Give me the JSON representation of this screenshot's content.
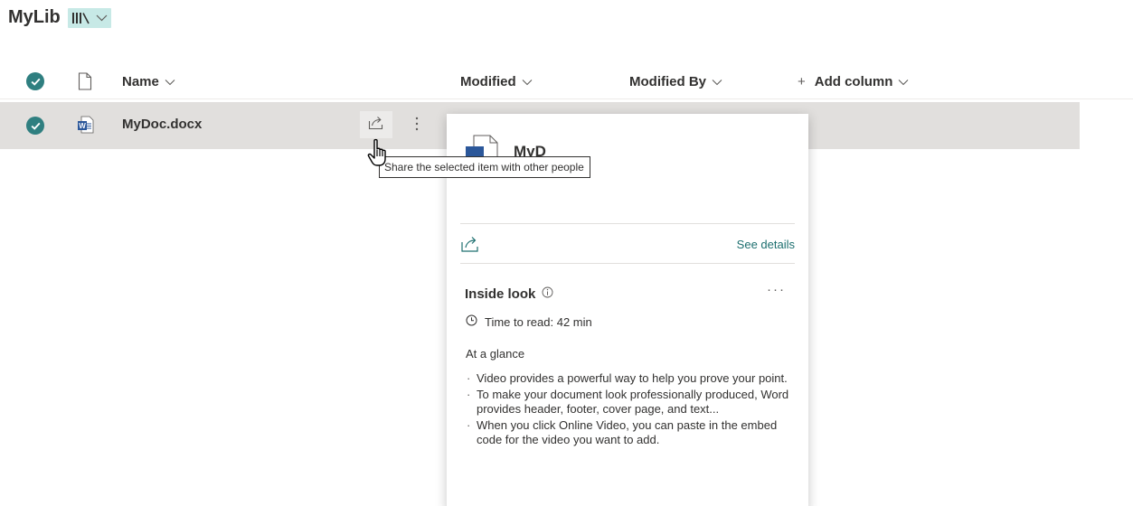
{
  "library": {
    "title": "MyLib",
    "view_icon": "library-icon",
    "view_chevron": "chevron-down-icon"
  },
  "columns": {
    "name": "Name",
    "modified": "Modified",
    "modified_by": "Modified By",
    "add_column": "Add column",
    "add_column_prefix": "+",
    "chevron": "∨"
  },
  "row": {
    "file_name": "MyDoc.docx",
    "file_icon": "word-doc-icon",
    "selected": true
  },
  "tooltip": {
    "text": "Share the selected item with other people"
  },
  "card": {
    "file_name": "MyD",
    "see_details": "See details",
    "inside_look": "Inside look",
    "more": "···",
    "time_to_read": "Time to read: 42 min",
    "at_a_glance": "At a glance",
    "bullets": [
      "Video provides a powerful way to help you prove your point.",
      "To make your document look professionally produced, Word provides header, footer, cover page, and text...",
      "When you click Online Video, you can paste in the embed code for the video you want to add."
    ]
  },
  "colors": {
    "accent": "#2f7f80",
    "selected_row": "#e1dfdd",
    "view_pill": "#c7e9e6",
    "link": "#1d6f6f"
  }
}
